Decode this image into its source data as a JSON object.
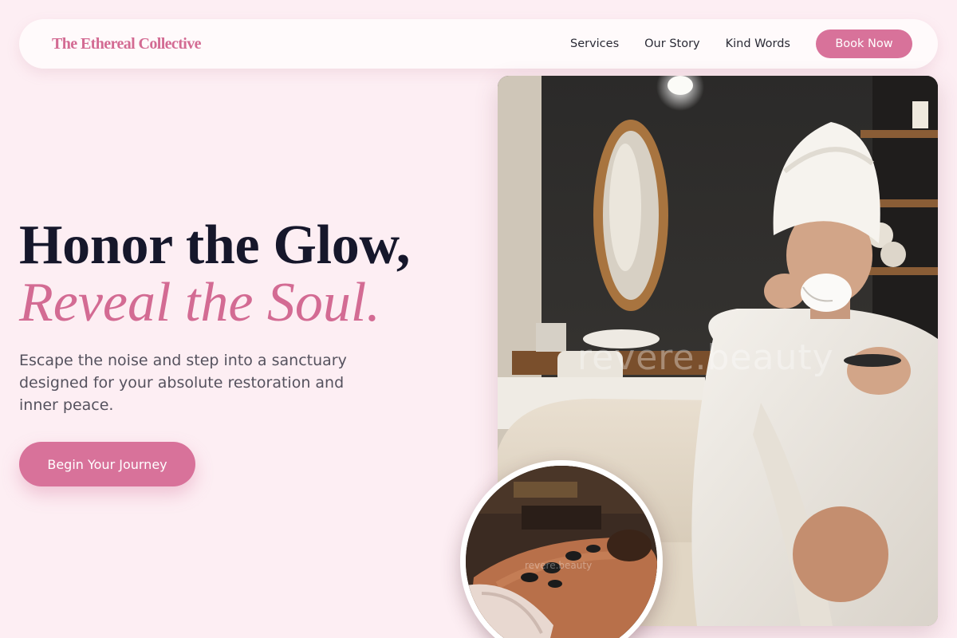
{
  "nav": {
    "brand": "The Ethereal Collective",
    "links": [
      {
        "label": "Services"
      },
      {
        "label": "Our Story"
      },
      {
        "label": "Kind Words"
      }
    ],
    "book_label": "Book Now"
  },
  "hero": {
    "headline_1": "Honor the Glow,",
    "headline_2": "Reveal the Soul.",
    "subtext": "Escape the noise and step into a sanctuary designed for your absolute restoration and inner peace.",
    "cta_label": "Begin Your Journey"
  },
  "images": {
    "main_watermark": "revere.beauty",
    "inset_watermark": "revere.beauty"
  },
  "colors": {
    "background": "#fdeef3",
    "accent": "#d8729a",
    "brand": "#d36b93",
    "headline": "#16172b"
  }
}
